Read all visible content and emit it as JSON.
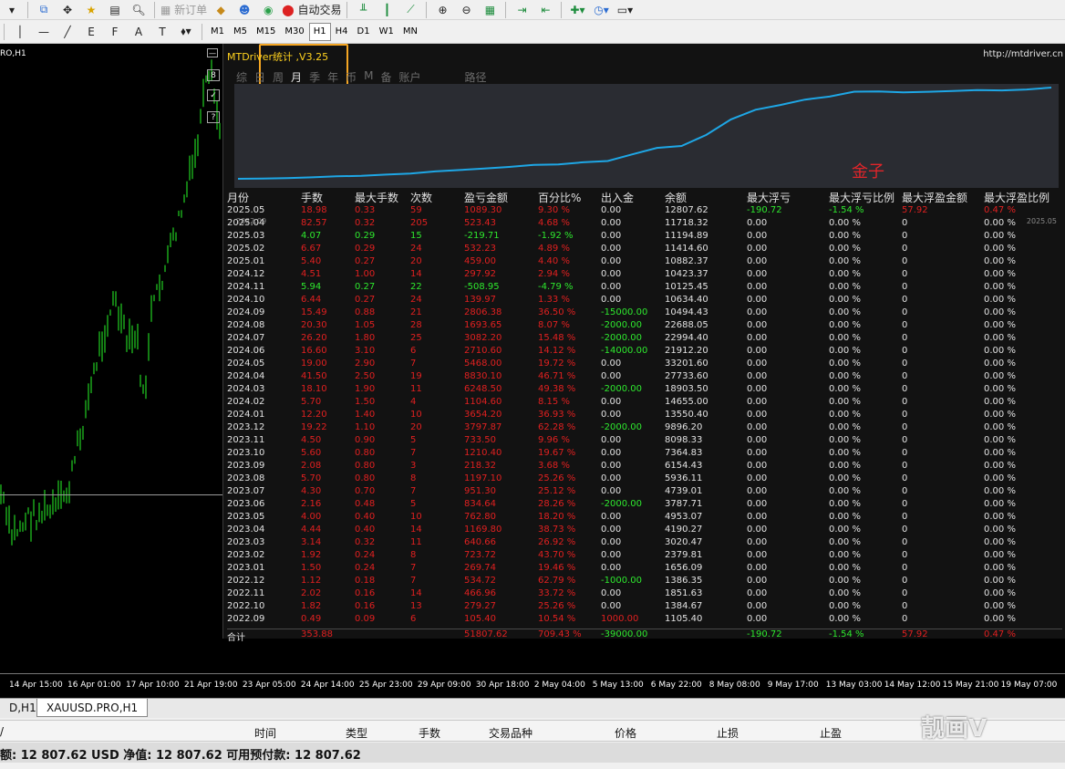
{
  "toolbar1": {
    "new_order": "新订单",
    "auto_trade": "自动交易"
  },
  "toolbar2": {
    "timeframes": [
      "M1",
      "M5",
      "M15",
      "M30",
      "H1",
      "H4",
      "D1",
      "W1",
      "MN"
    ],
    "active_tf": "H1",
    "tool_letters": [
      "A",
      "T",
      "F",
      "E"
    ]
  },
  "chart": {
    "symbol_label": "RO,H1",
    "x_labels": [
      "14 Apr 15:00",
      "16 Apr 01:00",
      "17 Apr 10:00",
      "21 Apr 19:00",
      "23 Apr 05:00",
      "24 Apr 14:00",
      "25 Apr 23:00",
      "29 Apr 09:00",
      "30 Apr 18:00",
      "2 May 04:00",
      "5 May 13:00",
      "6 May 22:00",
      "8 May 08:00",
      "9 May 17:00",
      "13 May 03:00",
      "14 May 12:00",
      "15 May 21:00",
      "19 May 07:00"
    ],
    "side_buttons": [
      "8",
      "✓",
      "?"
    ]
  },
  "panel": {
    "title": "MTDriver统计 ,V3.25",
    "url": "http://mtdriver.cn",
    "tabs": [
      "综",
      "日",
      "周",
      "月",
      "季",
      "年",
      "币",
      "M",
      "备",
      "账户",
      "路径"
    ],
    "active_tab": "月",
    "equity_label": "金子",
    "date_start": "2022.09",
    "date_end": "2025.05",
    "headers": [
      "月份",
      "手数",
      "最大手数",
      "次数",
      "盈亏金额",
      "百分比%",
      "出入金",
      "余额",
      "最大浮亏",
      "最大浮亏比例",
      "最大浮盈金额",
      "最大浮盈比例"
    ],
    "rows": [
      [
        "2025.05",
        "18.98",
        "0.33",
        "59",
        "1089.30",
        "9.30 %",
        "0.00",
        "12807.62",
        "-190.72",
        "-1.54 %",
        "57.92",
        "0.47 %"
      ],
      [
        "2025.04",
        "82.57",
        "0.32",
        "205",
        "523.43",
        "4.68 %",
        "0.00",
        "11718.32",
        "0.00",
        "0.00 %",
        "0",
        "0.00 %"
      ],
      [
        "2025.03",
        "4.07",
        "0.29",
        "15",
        "-219.71",
        "-1.92 %",
        "0.00",
        "11194.89",
        "0.00",
        "0.00 %",
        "0",
        "0.00 %"
      ],
      [
        "2025.02",
        "6.67",
        "0.29",
        "24",
        "532.23",
        "4.89 %",
        "0.00",
        "11414.60",
        "0.00",
        "0.00 %",
        "0",
        "0.00 %"
      ],
      [
        "2025.01",
        "5.40",
        "0.27",
        "20",
        "459.00",
        "4.40 %",
        "0.00",
        "10882.37",
        "0.00",
        "0.00 %",
        "0",
        "0.00 %"
      ],
      [
        "2024.12",
        "4.51",
        "1.00",
        "14",
        "297.92",
        "2.94 %",
        "0.00",
        "10423.37",
        "0.00",
        "0.00 %",
        "0",
        "0.00 %"
      ],
      [
        "2024.11",
        "5.94",
        "0.27",
        "22",
        "-508.95",
        "-4.79 %",
        "0.00",
        "10125.45",
        "0.00",
        "0.00 %",
        "0",
        "0.00 %"
      ],
      [
        "2024.10",
        "6.44",
        "0.27",
        "24",
        "139.97",
        "1.33 %",
        "0.00",
        "10634.40",
        "0.00",
        "0.00 %",
        "0",
        "0.00 %"
      ],
      [
        "2024.09",
        "15.49",
        "0.88",
        "21",
        "2806.38",
        "36.50 %",
        "-15000.00",
        "10494.43",
        "0.00",
        "0.00 %",
        "0",
        "0.00 %"
      ],
      [
        "2024.08",
        "20.30",
        "1.05",
        "28",
        "1693.65",
        "8.07 %",
        "-2000.00",
        "22688.05",
        "0.00",
        "0.00 %",
        "0",
        "0.00 %"
      ],
      [
        "2024.07",
        "26.20",
        "1.80",
        "25",
        "3082.20",
        "15.48 %",
        "-2000.00",
        "22994.40",
        "0.00",
        "0.00 %",
        "0",
        "0.00 %"
      ],
      [
        "2024.06",
        "16.60",
        "3.10",
        "6",
        "2710.60",
        "14.12 %",
        "-14000.00",
        "21912.20",
        "0.00",
        "0.00 %",
        "0",
        "0.00 %"
      ],
      [
        "2024.05",
        "19.00",
        "2.90",
        "7",
        "5468.00",
        "19.72 %",
        "0.00",
        "33201.60",
        "0.00",
        "0.00 %",
        "0",
        "0.00 %"
      ],
      [
        "2024.04",
        "41.50",
        "2.50",
        "19",
        "8830.10",
        "46.71 %",
        "0.00",
        "27733.60",
        "0.00",
        "0.00 %",
        "0",
        "0.00 %"
      ],
      [
        "2024.03",
        "18.10",
        "1.90",
        "11",
        "6248.50",
        "49.38 %",
        "-2000.00",
        "18903.50",
        "0.00",
        "0.00 %",
        "0",
        "0.00 %"
      ],
      [
        "2024.02",
        "5.70",
        "1.50",
        "4",
        "1104.60",
        "8.15 %",
        "0.00",
        "14655.00",
        "0.00",
        "0.00 %",
        "0",
        "0.00 %"
      ],
      [
        "2024.01",
        "12.20",
        "1.40",
        "10",
        "3654.20",
        "36.93 %",
        "0.00",
        "13550.40",
        "0.00",
        "0.00 %",
        "0",
        "0.00 %"
      ],
      [
        "2023.12",
        "19.22",
        "1.10",
        "20",
        "3797.87",
        "62.28 %",
        "-2000.00",
        "9896.20",
        "0.00",
        "0.00 %",
        "0",
        "0.00 %"
      ],
      [
        "2023.11",
        "4.50",
        "0.90",
        "5",
        "733.50",
        "9.96 %",
        "0.00",
        "8098.33",
        "0.00",
        "0.00 %",
        "0",
        "0.00 %"
      ],
      [
        "2023.10",
        "5.60",
        "0.80",
        "7",
        "1210.40",
        "19.67 %",
        "0.00",
        "7364.83",
        "0.00",
        "0.00 %",
        "0",
        "0.00 %"
      ],
      [
        "2023.09",
        "2.08",
        "0.80",
        "3",
        "218.32",
        "3.68 %",
        "0.00",
        "6154.43",
        "0.00",
        "0.00 %",
        "0",
        "0.00 %"
      ],
      [
        "2023.08",
        "5.70",
        "0.80",
        "8",
        "1197.10",
        "25.26 %",
        "0.00",
        "5936.11",
        "0.00",
        "0.00 %",
        "0",
        "0.00 %"
      ],
      [
        "2023.07",
        "4.30",
        "0.70",
        "7",
        "951.30",
        "25.12 %",
        "0.00",
        "4739.01",
        "0.00",
        "0.00 %",
        "0",
        "0.00 %"
      ],
      [
        "2023.06",
        "2.16",
        "0.48",
        "5",
        "834.64",
        "28.26 %",
        "-2000.00",
        "3787.71",
        "0.00",
        "0.00 %",
        "0",
        "0.00 %"
      ],
      [
        "2023.05",
        "4.00",
        "0.40",
        "10",
        "762.80",
        "18.20 %",
        "0.00",
        "4953.07",
        "0.00",
        "0.00 %",
        "0",
        "0.00 %"
      ],
      [
        "2023.04",
        "4.44",
        "0.40",
        "14",
        "1169.80",
        "38.73 %",
        "0.00",
        "4190.27",
        "0.00",
        "0.00 %",
        "0",
        "0.00 %"
      ],
      [
        "2023.03",
        "3.14",
        "0.32",
        "11",
        "640.66",
        "26.92 %",
        "0.00",
        "3020.47",
        "0.00",
        "0.00 %",
        "0",
        "0.00 %"
      ],
      [
        "2023.02",
        "1.92",
        "0.24",
        "8",
        "723.72",
        "43.70 %",
        "0.00",
        "2379.81",
        "0.00",
        "0.00 %",
        "0",
        "0.00 %"
      ],
      [
        "2023.01",
        "1.50",
        "0.24",
        "7",
        "269.74",
        "19.46 %",
        "0.00",
        "1656.09",
        "0.00",
        "0.00 %",
        "0",
        "0.00 %"
      ],
      [
        "2022.12",
        "1.12",
        "0.18",
        "7",
        "534.72",
        "62.79 %",
        "-1000.00",
        "1386.35",
        "0.00",
        "0.00 %",
        "0",
        "0.00 %"
      ],
      [
        "2022.11",
        "2.02",
        "0.16",
        "14",
        "466.96",
        "33.72 %",
        "0.00",
        "1851.63",
        "0.00",
        "0.00 %",
        "0",
        "0.00 %"
      ],
      [
        "2022.10",
        "1.82",
        "0.16",
        "13",
        "279.27",
        "25.26 %",
        "0.00",
        "1384.67",
        "0.00",
        "0.00 %",
        "0",
        "0.00 %"
      ],
      [
        "2022.09",
        "0.49",
        "0.09",
        "6",
        "105.40",
        "10.54 %",
        "1000.00",
        "1105.40",
        "0.00",
        "0.00 %",
        "0",
        "0.00 %"
      ]
    ],
    "total": [
      "合计",
      "353.88",
      "",
      "",
      "51807.62",
      "709.43 %",
      "-39000.00",
      "",
      "-190.72",
      "-1.54 %",
      "57.92",
      "0.47 %"
    ]
  },
  "bottom": {
    "tabs": [
      "D,H1",
      "XAUUSD.PRO,H1"
    ],
    "active_tab": "XAUUSD.PRO,H1",
    "columns": [
      "/",
      "时间",
      "类型",
      "手数",
      "交易品种",
      "价格",
      "止损",
      "止盈"
    ],
    "balance_text": "额: 12 807.62 USD  净值: 12 807.62  可用预付款: 12 807.62",
    "watermark": "靓画V"
  },
  "colors": {
    "profit": "#e02020",
    "loss": "#2ee82e",
    "title": "#ffd21e",
    "highlight": "#f5a623",
    "equity_line": "#1ea7e6"
  }
}
